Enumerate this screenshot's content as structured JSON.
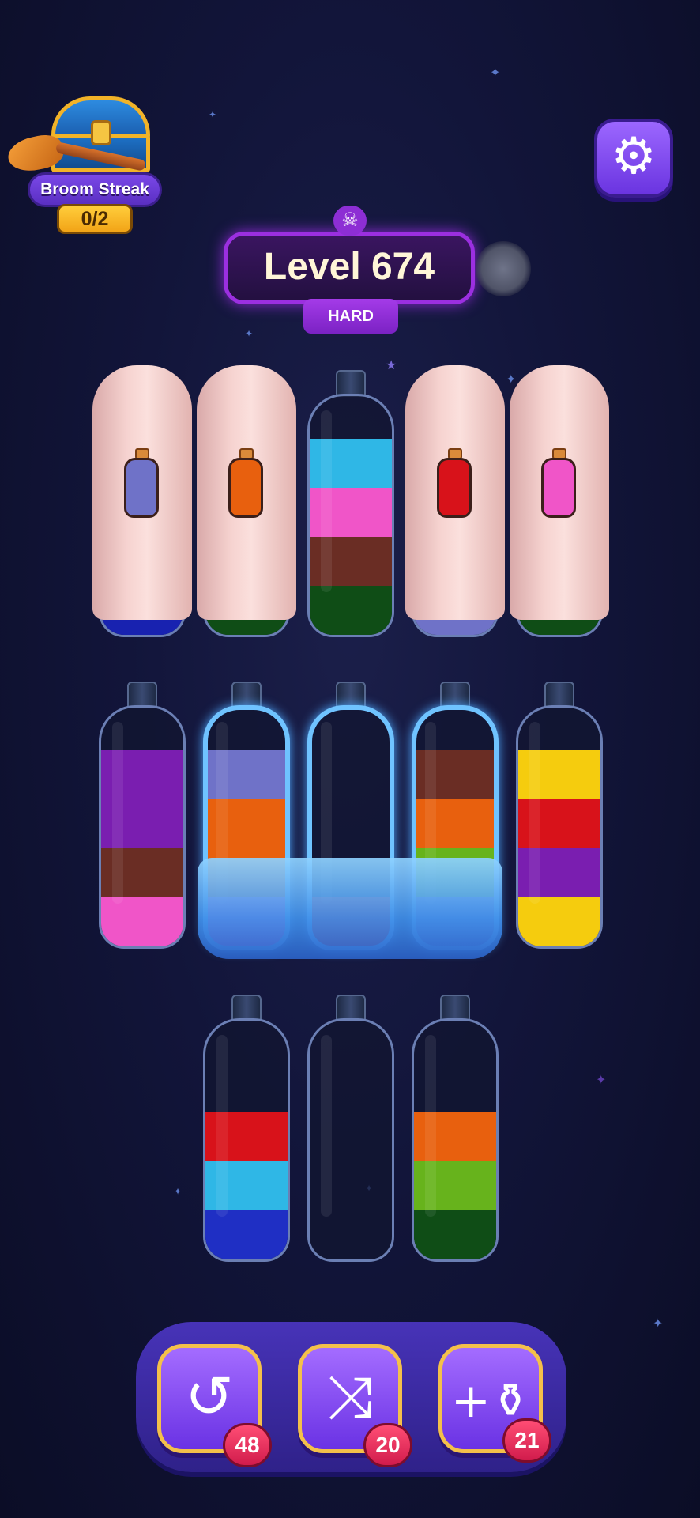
{
  "header": {
    "broom_streak": {
      "label": "Broom Streak",
      "count": "0/2"
    },
    "settings_icon": "gear-icon"
  },
  "level": {
    "title": "Level 674",
    "difficulty": "HARD",
    "icon": "skull-icon"
  },
  "colors": {
    "cyan": "#2fb7e6",
    "pink": "#f055c8",
    "brown": "#6a2d24",
    "darkgreen": "#0f4d16",
    "purple": "#7a1eb0",
    "orange": "#e8600e",
    "red": "#d8121a",
    "lightgreen": "#67b31c",
    "yellow": "#f5cc0e",
    "blue": "#1f2fc4",
    "lavender": "#6f72c8",
    "navy": "#1822b0"
  },
  "bottles": [
    {
      "id": "b1",
      "covered": true,
      "cover_hint": "lavender",
      "visible_bottom": "navy"
    },
    {
      "id": "b2",
      "covered": true,
      "cover_hint": "orange",
      "visible_bottom": "darkgreen"
    },
    {
      "id": "b3",
      "covered": false,
      "layers_bottom_to_top": [
        "darkgreen",
        "brown",
        "pink",
        "cyan"
      ]
    },
    {
      "id": "b4",
      "covered": true,
      "cover_hint": "red",
      "visible_bottom": "lavender"
    },
    {
      "id": "b5",
      "covered": true,
      "cover_hint": "pink",
      "visible_bottom": "darkgreen"
    },
    {
      "id": "b6",
      "covered": false,
      "layers_bottom_to_top": [
        "pink",
        "brown",
        "purple",
        "purple"
      ]
    },
    {
      "id": "b7",
      "covered": false,
      "frozen": true,
      "layers_bottom_to_top": [
        "pink",
        "orange",
        "orange",
        "lavender"
      ]
    },
    {
      "id": "b8",
      "covered": false,
      "frozen": true,
      "layers_bottom_to_top": [
        "red"
      ]
    },
    {
      "id": "b9",
      "covered": false,
      "frozen": true,
      "layers_bottom_to_top": [
        "lavender",
        "lightgreen",
        "orange",
        "brown"
      ]
    },
    {
      "id": "b10",
      "covered": false,
      "layers_bottom_to_top": [
        "yellow",
        "purple",
        "red",
        "yellow"
      ]
    },
    {
      "id": "b11",
      "covered": false,
      "layers_bottom_to_top": [
        "blue",
        "cyan",
        "red"
      ]
    },
    {
      "id": "b12",
      "covered": false,
      "layers_bottom_to_top": []
    },
    {
      "id": "b13",
      "covered": false,
      "layers_bottom_to_top": [
        "darkgreen",
        "lightgreen",
        "orange"
      ]
    }
  ],
  "toolbar": {
    "undo": {
      "icon": "undo-icon",
      "count": "48"
    },
    "shuffle": {
      "icon": "shuffle-icon",
      "count": "20"
    },
    "add_bottle": {
      "icon": "add-bottle-icon",
      "count": "21"
    }
  }
}
